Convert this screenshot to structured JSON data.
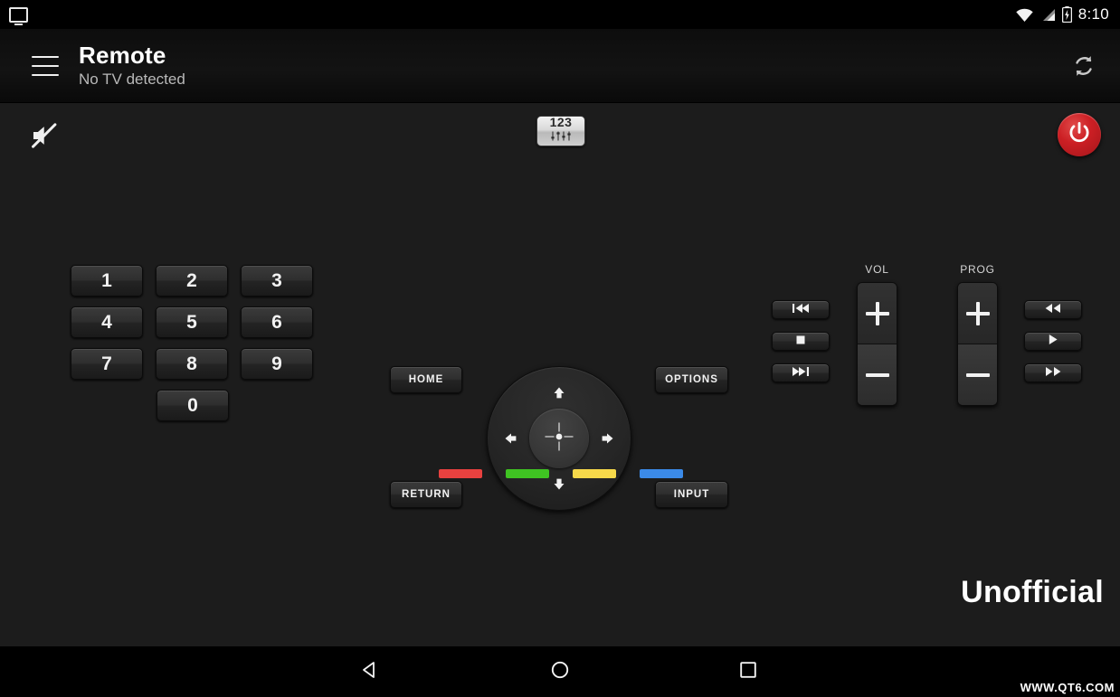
{
  "status_bar": {
    "cast_icon": "cast-screen-icon",
    "wifi_icon": "wifi-icon",
    "signal_icon": "cellular-signal-icon",
    "battery_icon": "battery-charging-icon",
    "time": "8:10"
  },
  "header": {
    "menu_icon": "hamburger-menu-icon",
    "title": "Remote",
    "subtitle": "No TV detected",
    "refresh_icon": "refresh-sync-icon"
  },
  "top_row": {
    "mute_icon": "volume-mute-icon",
    "numeric_toggle_label": "123",
    "numeric_toggle_icon": "sliders-icon",
    "power_icon": "power-icon"
  },
  "keypad": {
    "rows": [
      [
        "1",
        "2",
        "3"
      ],
      [
        "4",
        "5",
        "6"
      ],
      [
        "7",
        "8",
        "9"
      ]
    ],
    "zero": "0"
  },
  "dpad": {
    "up_icon": "arrow-up-icon",
    "down_icon": "arrow-down-icon",
    "left_icon": "arrow-left-icon",
    "right_icon": "arrow-right-icon",
    "center_icon": "crosshair-ok-icon"
  },
  "side_buttons": {
    "home": "HOME",
    "return": "RETURN",
    "options": "OPTIONS",
    "input": "INPUT"
  },
  "transport_left": [
    {
      "name": "previous-track",
      "icon": "skip-previous-icon"
    },
    {
      "name": "stop",
      "icon": "stop-icon"
    },
    {
      "name": "next-track",
      "icon": "skip-next-icon"
    }
  ],
  "transport_right": [
    {
      "name": "rewind",
      "icon": "rewind-icon"
    },
    {
      "name": "play",
      "icon": "play-icon"
    },
    {
      "name": "fast-forward",
      "icon": "fast-forward-icon"
    }
  ],
  "rockers": {
    "volume": {
      "label": "VOL",
      "plus": "+",
      "minus": "−"
    },
    "program": {
      "label": "PROG",
      "plus": "+",
      "minus": "−"
    }
  },
  "color_keys": [
    {
      "name": "red",
      "color": "#e8413f"
    },
    {
      "name": "green",
      "color": "#3fc322"
    },
    {
      "name": "yellow",
      "color": "#f7d94a"
    },
    {
      "name": "blue",
      "color": "#3b8ae8"
    }
  ],
  "branding": {
    "unofficial": "Unofficial",
    "watermark": "WWW.QT6.COM"
  },
  "nav_bar": {
    "back_icon": "nav-back-triangle-icon",
    "home_icon": "nav-home-circle-icon",
    "recents_icon": "nav-recents-square-icon"
  },
  "colors": {
    "background": "#1c1c1c",
    "header": "#101010",
    "power_red": "#cc1f24",
    "text_primary": "#ffffff",
    "text_secondary": "#b9b9b9"
  }
}
